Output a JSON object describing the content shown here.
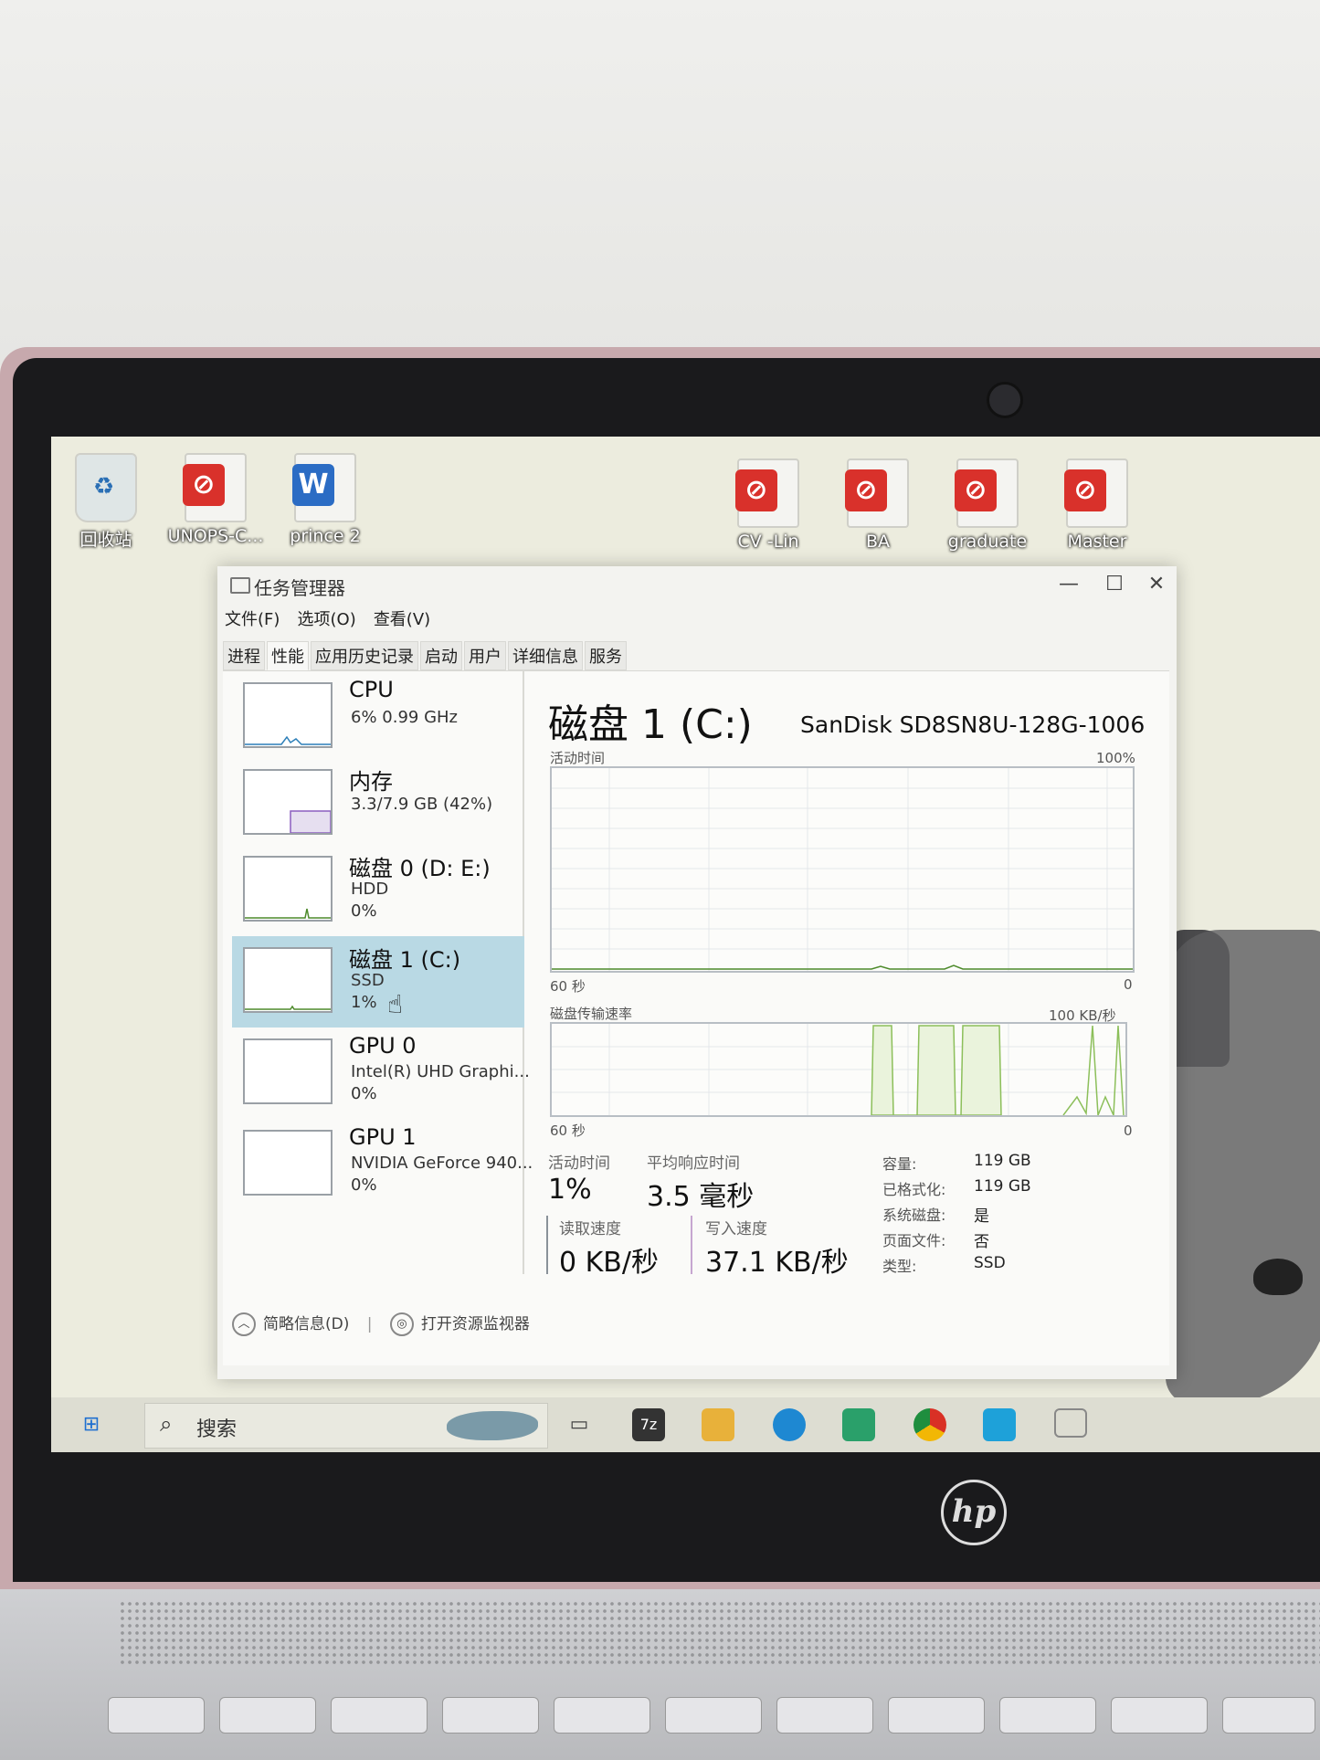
{
  "desktop": {
    "icons": [
      {
        "label": "回收站",
        "kind": "recycle"
      },
      {
        "label": "UNOPS-C...",
        "kind": "pdf"
      },
      {
        "label": "prince 2",
        "kind": "word"
      },
      {
        "label": "CV -Lin",
        "kind": "pdf"
      },
      {
        "label": "BA",
        "kind": "pdf"
      },
      {
        "label": "graduate",
        "kind": "pdf"
      },
      {
        "label": "Master",
        "kind": "pdf"
      }
    ]
  },
  "window": {
    "title": "任务管理器",
    "controls": {
      "minimize": "—",
      "maximize": "☐",
      "close": "✕"
    },
    "menu": [
      "文件(F)",
      "选项(O)",
      "查看(V)"
    ],
    "tabs": [
      "进程",
      "性能",
      "应用历史记录",
      "启动",
      "用户",
      "详细信息",
      "服务"
    ],
    "active_tab": "性能"
  },
  "sidebar": {
    "items": [
      {
        "name": "CPU",
        "line1": "6%  0.99 GHz",
        "line2": ""
      },
      {
        "name": "内存",
        "line1": "3.3/7.9 GB (42%)",
        "line2": ""
      },
      {
        "name": "磁盘 0 (D: E:)",
        "line1": "HDD",
        "line2": "0%"
      },
      {
        "name": "磁盘 1 (C:)",
        "line1": "SSD",
        "line2": "1%"
      },
      {
        "name": "GPU 0",
        "line1": "Intel(R) UHD Graphi...",
        "line2": "0%"
      },
      {
        "name": "GPU 1",
        "line1": "NVIDIA GeForce 940...",
        "line2": "0%"
      }
    ],
    "selected_index": 3
  },
  "main": {
    "title": "磁盘 1 (C:)",
    "model": "SanDisk SD8SN8U-128G-1006",
    "graph1": {
      "label": "活动时间",
      "max": "100%",
      "left": "60 秒",
      "right": "0"
    },
    "graph2": {
      "label": "磁盘传输速率",
      "max": "100 KB/秒",
      "left": "60 秒",
      "right": "0"
    },
    "stats": {
      "active_time_label": "活动时间",
      "active_time": "1%",
      "response_label": "平均响应时间",
      "response": "3.5 毫秒",
      "read_label": "读取速度",
      "read": "0 KB/秒",
      "write_label": "写入速度",
      "write": "37.1 KB/秒"
    },
    "props": [
      {
        "key": "容量:",
        "value": "119 GB"
      },
      {
        "key": "已格式化:",
        "value": "119 GB"
      },
      {
        "key": "系统磁盘:",
        "value": "是"
      },
      {
        "key": "页面文件:",
        "value": "否"
      },
      {
        "key": "类型:",
        "value": "SSD"
      }
    ]
  },
  "footer": {
    "summary": "简略信息(D)",
    "resmon": "打开资源监视器"
  },
  "taskbar": {
    "search_placeholder": "搜索",
    "apps": [
      "start-icon",
      "task-view-icon",
      "7zip-icon",
      "file-explorer-icon",
      "edge-icon",
      "store-icon",
      "chrome-icon",
      "app-icon",
      "task-manager-icon"
    ]
  },
  "brand": "hp"
}
